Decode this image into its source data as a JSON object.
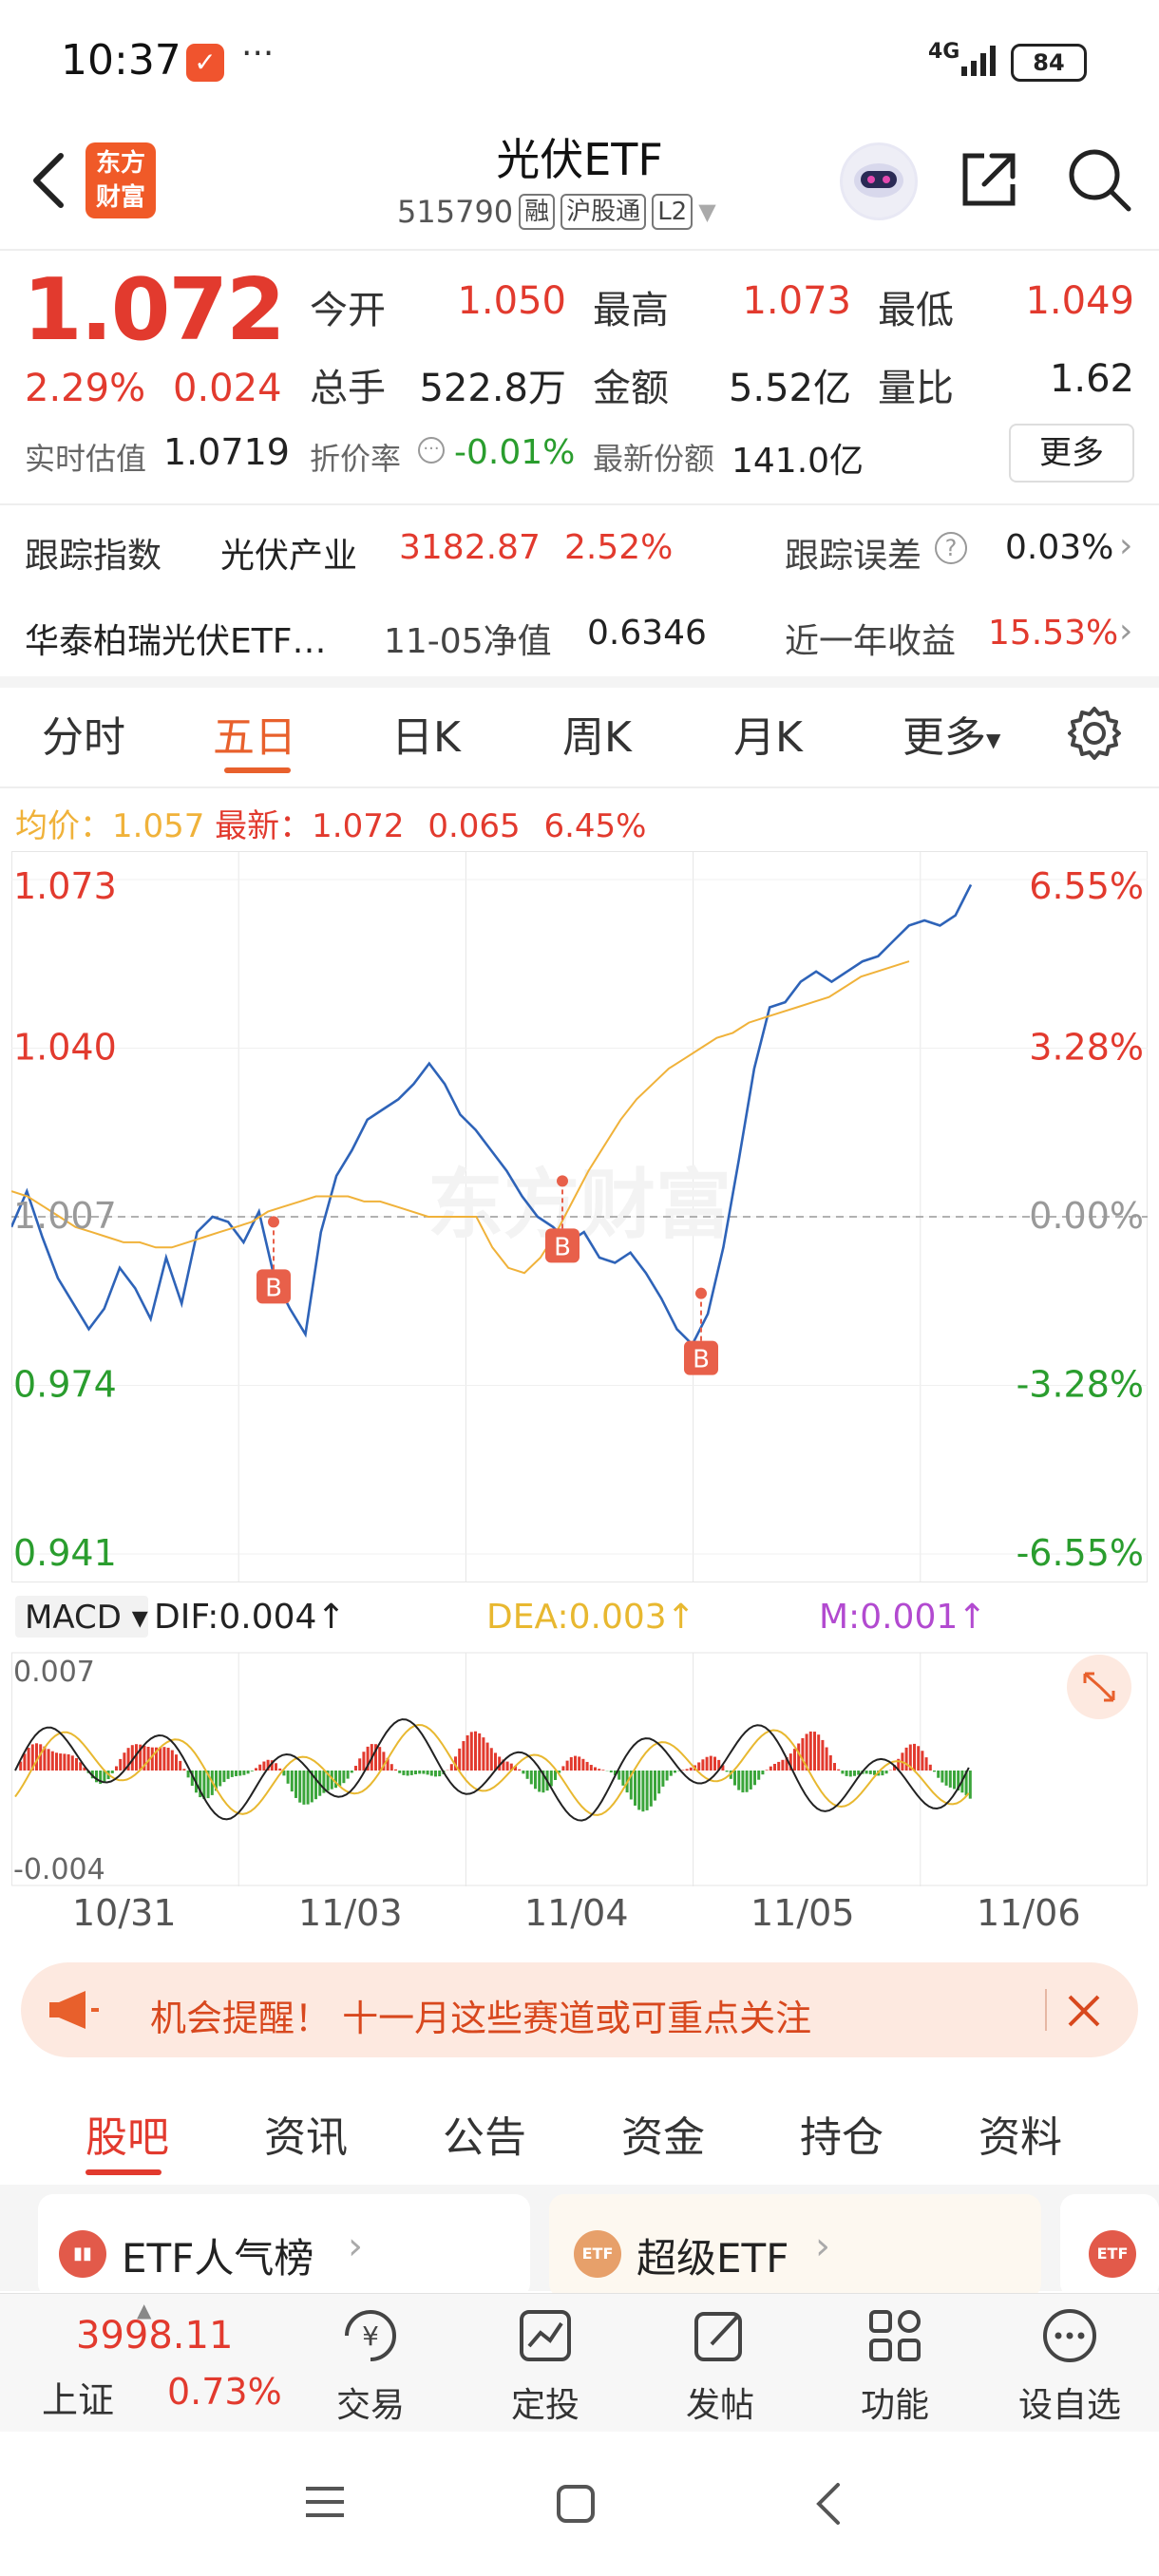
{
  "status_bar": {
    "time": "10:37",
    "app_icon": "✓",
    "more_dots": "···",
    "network": "4G",
    "battery": "84"
  },
  "header": {
    "logo_line1": "东方",
    "logo_line2": "财富",
    "title": "光伏ETF",
    "code": "515790",
    "tags": [
      "融",
      "沪股通",
      "L2"
    ]
  },
  "quote": {
    "price": "1.072",
    "change_pct": "2.29%",
    "change": "0.024",
    "open_label": "今开",
    "open": "1.050",
    "high_label": "最高",
    "high": "1.073",
    "low_label": "最低",
    "low": "1.049",
    "volume_label": "总手",
    "volume": "522.8万",
    "amount_label": "金额",
    "amount": "5.52亿",
    "vol_ratio_label": "量比",
    "vol_ratio": "1.62",
    "iopv_label": "实时估值",
    "iopv": "1.0719",
    "discount_label": "折价率",
    "discount": "-0.01%",
    "shares_label": "最新份额",
    "shares": "141.0亿",
    "more_button": "更多"
  },
  "tracking": {
    "index_label": "跟踪指数",
    "index_name": "光伏产业",
    "index_value": "3182.87",
    "index_pct": "2.52%",
    "error_label": "跟踪误差",
    "error_value": "0.03%",
    "fund_name": "华泰柏瑞光伏ETF…",
    "nav_label": "11-05净值",
    "nav_value": "0.6346",
    "yield_label": "近一年收益",
    "yield_value": "15.53%"
  },
  "chart_tabs": [
    "分时",
    "五日",
    "日K",
    "周K",
    "月K",
    "更多"
  ],
  "chart_tabs_active": 1,
  "avg_line": {
    "avg_label": "均价：",
    "avg_value": "1.057",
    "last_label": "最新：",
    "last_value": "1.072",
    "chg": "0.065",
    "pct": "6.45%"
  },
  "chart_data": {
    "type": "line",
    "x": [
      "10/31",
      "11/03",
      "11/04",
      "11/05",
      "11/06"
    ],
    "ylim": [
      0.941,
      1.073
    ],
    "y_ticks_left": [
      "1.073",
      "1.040",
      "1.007",
      "0.974",
      "0.941"
    ],
    "y_ticks_right": [
      "6.55%",
      "3.28%",
      "0.00%",
      "-3.28%",
      "-6.55%"
    ],
    "reference": 1.007,
    "watermark": "东方财富",
    "trade_marker": "B",
    "series": [
      {
        "values": [
          1.005,
          1.012,
          1.003,
          0.995,
          0.99,
          0.985,
          0.989,
          0.997,
          0.993,
          0.987,
          0.999,
          0.99,
          1.004,
          1.007,
          1.006,
          1.002,
          1.008,
          0.995,
          0.989,
          0.984,
          1.004,
          1.015,
          1.02,
          1.026,
          1.028,
          1.03,
          1.033,
          1.037,
          1.033,
          1.027,
          1.024,
          1.02,
          1.016,
          1.011,
          1.007,
          1.005,
          1.002,
          1.004,
          0.999,
          0.998,
          1.0,
          0.996,
          0.991,
          0.985,
          0.982,
          0.988,
          1.001,
          1.018,
          1.036,
          1.048,
          1.049,
          1.053,
          1.055,
          1.053,
          1.055,
          1.057,
          1.058,
          1.061,
          1.064,
          1.065,
          1.064,
          1.066,
          1.072
        ]
      },
      {
        "values": [
          1.012,
          1.011,
          1.009,
          1.007,
          1.005,
          1.004,
          1.003,
          1.002,
          1.002,
          1.001,
          1.001,
          1.002,
          1.003,
          1.004,
          1.005,
          1.006,
          1.008,
          1.009,
          1.01,
          1.011,
          1.011,
          1.011,
          1.01,
          1.01,
          1.009,
          1.008,
          1.007,
          1.007,
          1.007,
          1.007,
          1.001,
          0.997,
          0.996,
          0.999,
          1.004,
          1.01,
          1.016,
          1.021,
          1.026,
          1.03,
          1.033,
          1.036,
          1.038,
          1.04,
          1.042,
          1.043,
          1.045,
          1.046,
          1.047,
          1.048,
          1.049,
          1.05,
          1.052,
          1.054,
          1.055,
          1.056,
          1.057
        ]
      }
    ],
    "buy_points": [
      {
        "x_index": 0,
        "value": 1.006
      },
      {
        "x_index": 1,
        "value": 1.014
      },
      {
        "x_index": 2,
        "value": 0.992
      }
    ]
  },
  "macd": {
    "selector": "MACD",
    "dif": "DIF:0.004",
    "dea": "DEA:0.003",
    "m": "M:0.001",
    "arrow": "↑",
    "top_tick": "0.007",
    "bottom_tick": "-0.004"
  },
  "dates": [
    "10/31",
    "11/03",
    "11/04",
    "11/05",
    "11/06"
  ],
  "banner": {
    "text": "机会提醒！  十一月这些赛道或可重点关注"
  },
  "bottom_tabs": [
    "股吧",
    "资讯",
    "公告",
    "资金",
    "持仓",
    "资料"
  ],
  "cards": [
    {
      "label": "ETF人气榜",
      "badge": "▮▮"
    },
    {
      "label": "超级ETF",
      "badge": "ETF"
    },
    {
      "label": "",
      "badge": "ETF"
    }
  ],
  "index_ticker": {
    "value": "3998.11",
    "name": "上证",
    "pct": "0.73%"
  },
  "nav": [
    "交易",
    "定投",
    "发帖",
    "功能",
    "设自选"
  ],
  "colors": {
    "up": "#e23a2e",
    "down": "#2a9d2e",
    "accent": "#e8602c",
    "line": "#2e63b8",
    "avg": "#f0b23a"
  }
}
